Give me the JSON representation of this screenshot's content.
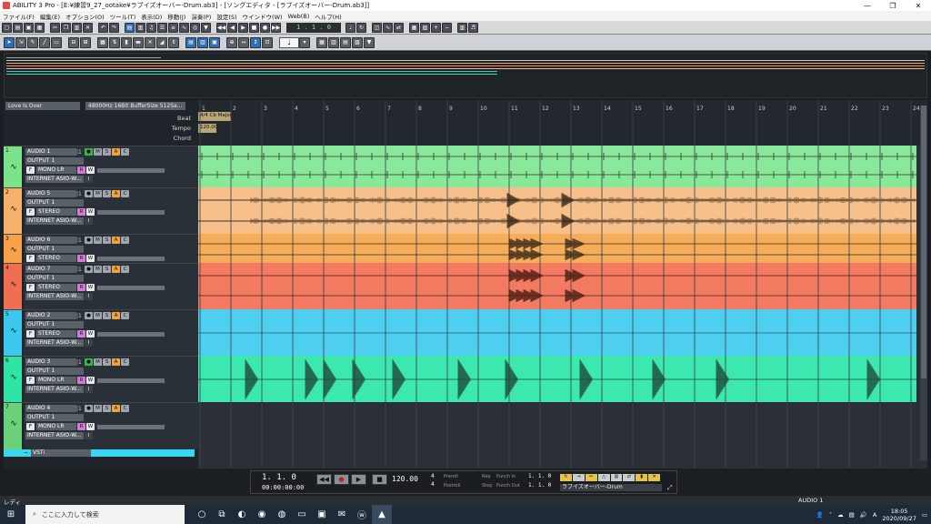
{
  "window": {
    "title": "ABILITY 3 Pro - [E:¥練習9_27_ootake¥ラブイズオーバー-Drum.ab3] - [ソングエディタ - [ラブイズオーバー-Drum.ab3]]",
    "minimize": "—",
    "maximize": "❐",
    "close": "✕"
  },
  "menu": [
    "ファイル(F)",
    "編集(E)",
    "オプション(O)",
    "ツール(T)",
    "表示(D)",
    "移動(J)",
    "演奏(P)",
    "設定(S)",
    "ウインドウ(W)",
    "Web(B)",
    "ヘルプ(H)"
  ],
  "toolbar1": {
    "position": "1 . 1 . 0"
  },
  "toolbar2": {
    "note_value": "♩"
  },
  "overview": {
    "line_colors": [
      "#d6d6d6",
      "#cfcfcf",
      "#f5a35a",
      "#f08a6a",
      "#39c3e8",
      "#2ee0a0",
      "#c9c9c9"
    ]
  },
  "header": {
    "song_title": "Love Is Over",
    "audio_info": "48000Hz 16Bit BufferSize 512Sa...",
    "beat_label": "Beat",
    "tempo_label": "Tempo",
    "chord_label": "Chord",
    "time_sig": "4/4 Cb Major",
    "tempo_value": "120.00"
  },
  "ruler": {
    "measures": [
      "1",
      "2",
      "3",
      "4",
      "5",
      "6",
      "7",
      "8",
      "9",
      "10",
      "11",
      "12",
      "13",
      "14",
      "15",
      "16",
      "17",
      "18",
      "19",
      "20",
      "21",
      "22",
      "23",
      "24"
    ]
  },
  "track_common": {
    "output": "OUTPUT 1",
    "input": "INTERNET ASIO-W...",
    "btn_f": "F",
    "btn_r": "R",
    "btn_w": "W",
    "btn_m": "M",
    "btn_s": "S",
    "btn_a": "A",
    "btn_c": "C",
    "btn_i": "I"
  },
  "tracks": [
    {
      "num": "1",
      "name": "AUDIO 1",
      "mode": "MONO LR",
      "color": "#7be38a"
    },
    {
      "num": "2",
      "name": "AUDIO 5",
      "mode": "STEREO",
      "color": "#f7b06a"
    },
    {
      "num": "3",
      "name": "AUDIO 6",
      "mode": "STEREO",
      "color": "#f6a24a"
    },
    {
      "num": "4",
      "name": "AUDIO 7",
      "mode": "STEREO",
      "color": "#f06e52"
    },
    {
      "num": "5",
      "name": "AUDIO 2",
      "mode": "STEREO",
      "color": "#3cc7ee"
    },
    {
      "num": "6",
      "name": "AUDIO 3",
      "mode": "MONO LR",
      "color": "#2ee5a5"
    },
    {
      "num": "7",
      "name": "AUDIO 4",
      "mode": "MONO LR",
      "color": "#6ad07a"
    }
  ],
  "vsti_label": "VSTi",
  "transport": {
    "position": "1.  1.  0",
    "time": "00:00:00:00",
    "tempo": "120.00",
    "beat_top": "4",
    "beat_bottom": "4",
    "punch_in_label": "Punch In",
    "punch_out_label": "Punch Out",
    "pre_roll_label": "Preroll",
    "post_roll_label": "Postroll",
    "rep_label": "Rep",
    "step_label": "Step",
    "punch_in_value": "1.  1.  0",
    "punch_out_value": "1.  1.  0",
    "song_name": "ラブイズオーバー-Drum"
  },
  "status": {
    "ready": "レディ",
    "track": "AUDIO 1"
  },
  "taskbar": {
    "search_placeholder": "ここに入力して検索",
    "time": "18:05",
    "date": "2020/09/27"
  }
}
